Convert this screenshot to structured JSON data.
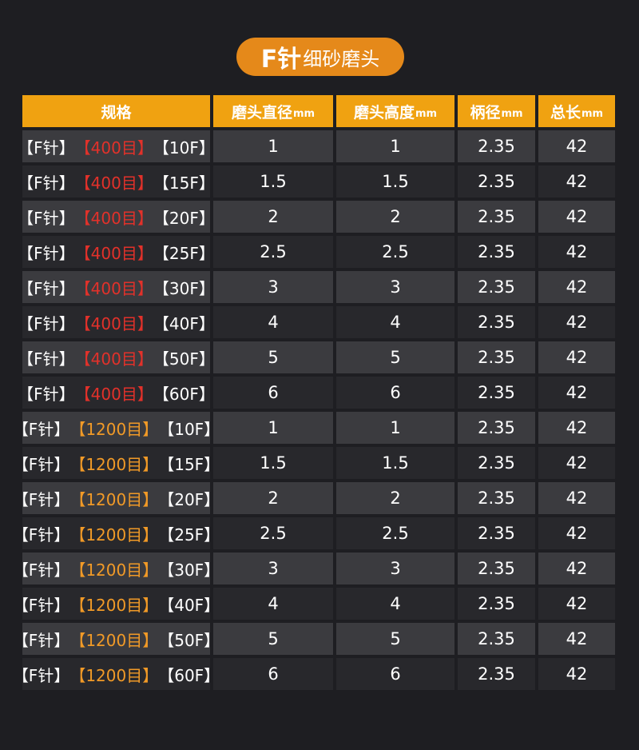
{
  "title": {
    "strong": "F针",
    "light": "细砂磨头",
    "accent_color": "#e5891a"
  },
  "table": {
    "header_color": "#f0a211",
    "columns": [
      {
        "label": "规格",
        "unit": ""
      },
      {
        "label": "磨头直径",
        "unit": "mm"
      },
      {
        "label": "磨头高度",
        "unit": "mm"
      },
      {
        "label": "柄径",
        "unit": "mm"
      },
      {
        "label": "总长",
        "unit": "mm"
      }
    ],
    "rows": [
      {
        "spec": {
          "prefix": "【F针】",
          "grit": "【400目】",
          "grit_color": "red",
          "suffix": "【10F】"
        },
        "diameter": "1",
        "height": "1",
        "shank": "2.35",
        "length": "42"
      },
      {
        "spec": {
          "prefix": "【F针】",
          "grit": "【400目】",
          "grit_color": "red",
          "suffix": "【15F】"
        },
        "diameter": "1.5",
        "height": "1.5",
        "shank": "2.35",
        "length": "42"
      },
      {
        "spec": {
          "prefix": "【F针】",
          "grit": "【400目】",
          "grit_color": "red",
          "suffix": "【20F】"
        },
        "diameter": "2",
        "height": "2",
        "shank": "2.35",
        "length": "42"
      },
      {
        "spec": {
          "prefix": "【F针】",
          "grit": "【400目】",
          "grit_color": "red",
          "suffix": "【25F】"
        },
        "diameter": "2.5",
        "height": "2.5",
        "shank": "2.35",
        "length": "42"
      },
      {
        "spec": {
          "prefix": "【F针】",
          "grit": "【400目】",
          "grit_color": "red",
          "suffix": "【30F】"
        },
        "diameter": "3",
        "height": "3",
        "shank": "2.35",
        "length": "42"
      },
      {
        "spec": {
          "prefix": "【F针】",
          "grit": "【400目】",
          "grit_color": "red",
          "suffix": "【40F】"
        },
        "diameter": "4",
        "height": "4",
        "shank": "2.35",
        "length": "42"
      },
      {
        "spec": {
          "prefix": "【F针】",
          "grit": "【400目】",
          "grit_color": "red",
          "suffix": "【50F】"
        },
        "diameter": "5",
        "height": "5",
        "shank": "2.35",
        "length": "42"
      },
      {
        "spec": {
          "prefix": "【F针】",
          "grit": "【400目】",
          "grit_color": "red",
          "suffix": "【60F】"
        },
        "diameter": "6",
        "height": "6",
        "shank": "2.35",
        "length": "42"
      },
      {
        "spec": {
          "prefix": "【F针】",
          "grit": "【1200目】",
          "grit_color": "orange",
          "suffix": "【10F】"
        },
        "diameter": "1",
        "height": "1",
        "shank": "2.35",
        "length": "42"
      },
      {
        "spec": {
          "prefix": "【F针】",
          "grit": "【1200目】",
          "grit_color": "orange",
          "suffix": "【15F】"
        },
        "diameter": "1.5",
        "height": "1.5",
        "shank": "2.35",
        "length": "42"
      },
      {
        "spec": {
          "prefix": "【F针】",
          "grit": "【1200目】",
          "grit_color": "orange",
          "suffix": "【20F】"
        },
        "diameter": "2",
        "height": "2",
        "shank": "2.35",
        "length": "42"
      },
      {
        "spec": {
          "prefix": "【F针】",
          "grit": "【1200目】",
          "grit_color": "orange",
          "suffix": "【25F】"
        },
        "diameter": "2.5",
        "height": "2.5",
        "shank": "2.35",
        "length": "42"
      },
      {
        "spec": {
          "prefix": "【F针】",
          "grit": "【1200目】",
          "grit_color": "orange",
          "suffix": "【30F】"
        },
        "diameter": "3",
        "height": "3",
        "shank": "2.35",
        "length": "42"
      },
      {
        "spec": {
          "prefix": "【F针】",
          "grit": "【1200目】",
          "grit_color": "orange",
          "suffix": "【40F】"
        },
        "diameter": "4",
        "height": "4",
        "shank": "2.35",
        "length": "42"
      },
      {
        "spec": {
          "prefix": "【F针】",
          "grit": "【1200目】",
          "grit_color": "orange",
          "suffix": "【50F】"
        },
        "diameter": "5",
        "height": "5",
        "shank": "2.35",
        "length": "42"
      },
      {
        "spec": {
          "prefix": "【F针】",
          "grit": "【1200目】",
          "grit_color": "orange",
          "suffix": "【60F】"
        },
        "diameter": "6",
        "height": "6",
        "shank": "2.35",
        "length": "42"
      }
    ]
  }
}
